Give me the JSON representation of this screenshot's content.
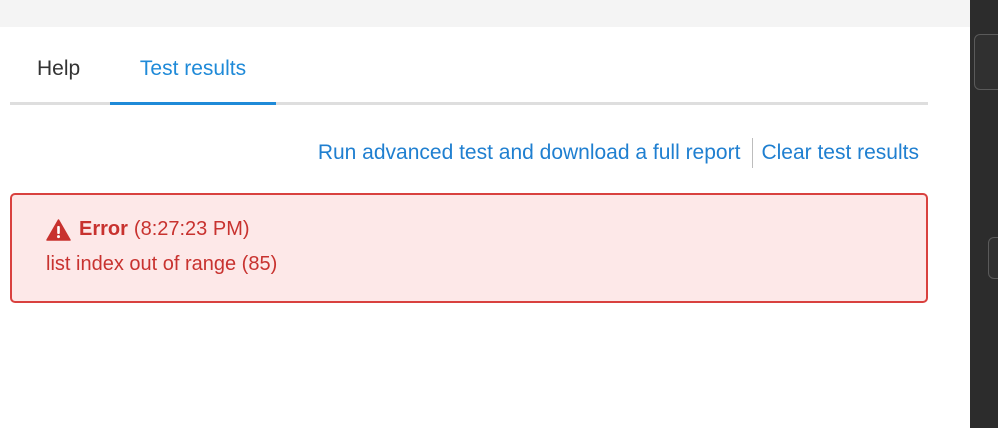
{
  "tabs": [
    {
      "label": "Help",
      "active": false
    },
    {
      "label": "Test results",
      "active": true
    }
  ],
  "actions": {
    "run_advanced": "Run advanced test and download a full report",
    "clear_results": "Clear test results"
  },
  "error": {
    "icon": "warning-icon",
    "label": "Error",
    "time": "(8:27:23 PM)",
    "message": "list index out of range (85)"
  },
  "colors": {
    "accent": "#1f8ad8",
    "error_text": "#c8322f",
    "error_border": "#d9413f",
    "error_bg": "#fde8e8"
  }
}
